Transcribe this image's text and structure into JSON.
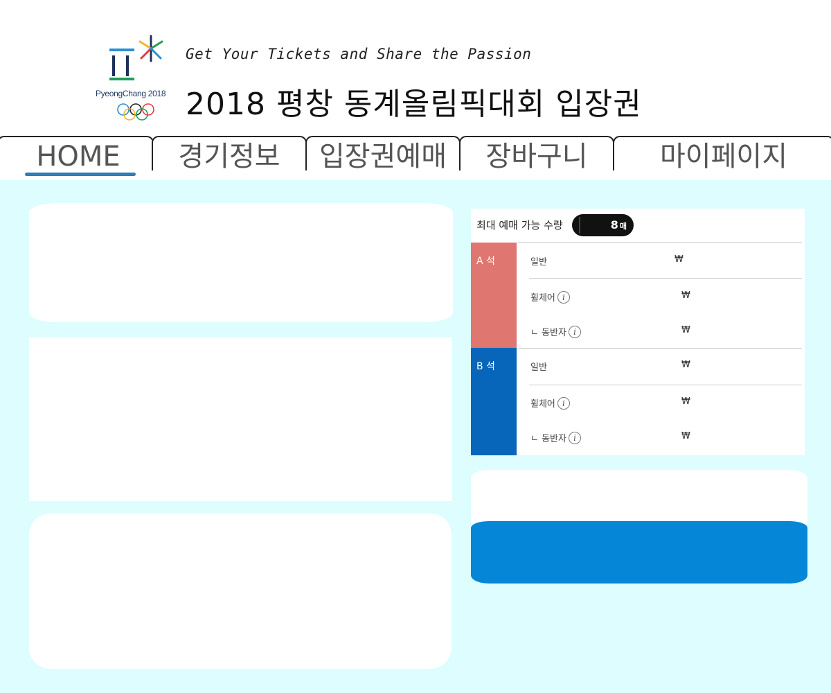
{
  "header": {
    "tagline": "Get Your Tickets and Share the Passion",
    "title": "2018 평창 동계올림픽대회 입장권",
    "logo_text": "PyeongChang 2018"
  },
  "nav": {
    "tabs": [
      {
        "label": "HOME",
        "active": true
      },
      {
        "label": "경기정보",
        "active": false
      },
      {
        "label": "입장권예매",
        "active": false
      },
      {
        "label": "장바구니",
        "active": false
      },
      {
        "label": "마이페이지",
        "active": false
      }
    ],
    "accent_color": "#2c7db8"
  },
  "ticket_table": {
    "max_label": "최대 예매 가능 수량",
    "max_count": "8",
    "max_unit": "매",
    "seats": [
      {
        "name": "A 석",
        "color": "#df7670",
        "rows": [
          {
            "type": "일반",
            "price": "₩",
            "info": false
          },
          {
            "type": "휠체어",
            "price": "₩",
            "info": true
          },
          {
            "type": "ㄴ 동반자",
            "price": "₩",
            "info": true
          }
        ]
      },
      {
        "name": "B 석",
        "color": "#0765ba",
        "rows": [
          {
            "type": "일반",
            "price": "₩",
            "info": false
          },
          {
            "type": "휠체어",
            "price": "₩",
            "info": true
          },
          {
            "type": "ㄴ 동반자",
            "price": "₩",
            "info": true
          }
        ]
      }
    ],
    "info_icon_glyph": "i"
  },
  "colors": {
    "background": "#ddfdfe",
    "buy_bar": "#0686d6"
  }
}
